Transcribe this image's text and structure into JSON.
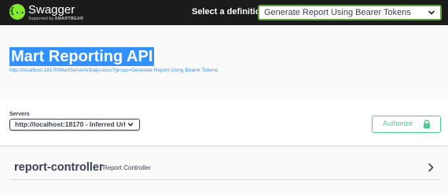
{
  "header": {
    "logo_name": "Swagger",
    "logo_sub_prefix": "Supported by",
    "logo_sub_brand": "SMARTBEAR",
    "logo_mark": "{...}",
    "definition_label": "Select a definition",
    "definition_value": "Generate Report Using Bearer Tokens"
  },
  "info": {
    "title": "Mart Reporting API",
    "url": "http://localhost:18170/MartServer/v3/api-docs?group=Generate Report Using Bearer Tokens"
  },
  "servers": {
    "label": "Servers",
    "selected": "http://localhost:18170 - Inferred Url"
  },
  "authorize": {
    "label": "Authorize"
  },
  "tags": [
    {
      "name": "report-controller",
      "description": "Report Controller"
    }
  ],
  "colors": {
    "topbar": "#1b1b1b",
    "swagger_green": "#85ea2d",
    "select_border": "#62a03f",
    "selection_highlight": "#3390ff",
    "link": "#4990e2",
    "authorize_green": "#49cc90",
    "text": "#3b4151"
  },
  "icons": {
    "definition_dropdown": "chevron-down-icon",
    "servers_dropdown": "chevron-down-icon",
    "authorize": "lock-icon",
    "tag_expand": "chevron-right-icon"
  }
}
